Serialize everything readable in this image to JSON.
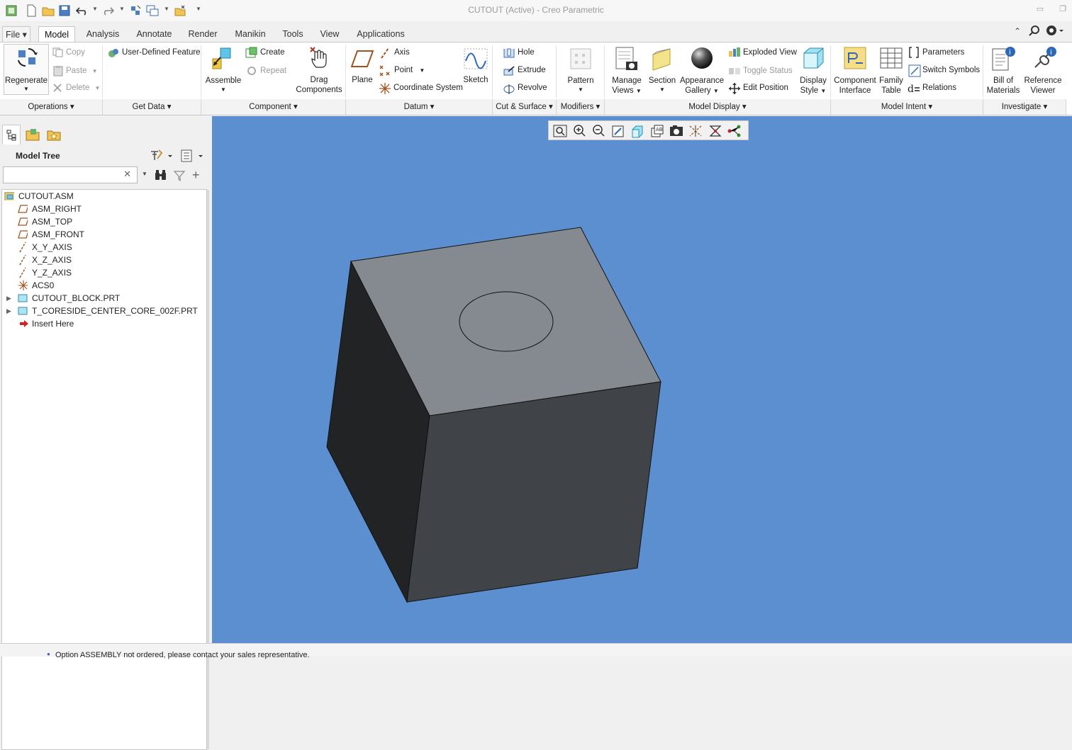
{
  "window": {
    "title": "CUTOUT (Active) - Creo Parametric"
  },
  "tabs": [
    "File",
    "Model",
    "Analysis",
    "Annotate",
    "Render",
    "Manikin",
    "Tools",
    "View",
    "Applications"
  ],
  "ribbon": {
    "operations": {
      "regenerate": "Regenerate",
      "copy": "Copy",
      "paste": "Paste",
      "delete": "Delete",
      "group": "Operations"
    },
    "get_data": {
      "udf": "User-Defined Feature",
      "group": "Get Data"
    },
    "component": {
      "assemble": "Assemble",
      "create": "Create",
      "repeat": "Repeat",
      "drag": [
        "Drag",
        "Components"
      ],
      "group": "Component"
    },
    "datum": {
      "plane": "Plane",
      "axis": "Axis",
      "point": "Point",
      "csys": "Coordinate System",
      "sketch": "Sketch",
      "group": "Datum"
    },
    "cut_surface": {
      "hole": "Hole",
      "extrude": "Extrude",
      "revolve": "Revolve",
      "group": "Cut & Surface"
    },
    "modifiers": {
      "pattern": "Pattern",
      "group": "Modifiers"
    },
    "model_display": {
      "manage_views": [
        "Manage",
        "Views"
      ],
      "section": "Section",
      "appearance": [
        "Appearance",
        "Gallery"
      ],
      "exploded": "Exploded View",
      "toggle_status": "Toggle Status",
      "edit_position": "Edit Position",
      "display_style": [
        "Display",
        "Style"
      ],
      "group": "Model Display"
    },
    "model_intent": {
      "component_interface": [
        "Component",
        "Interface"
      ],
      "family_table": [
        "Family",
        "Table"
      ],
      "parameters": "Parameters",
      "switch_symbols": "Switch Symbols",
      "relations": "Relations",
      "group": "Model Intent"
    },
    "investigate": {
      "bom": [
        "Bill of",
        "Materials"
      ],
      "ref_viewer": [
        "Reference",
        "Viewer"
      ],
      "group": "Investigate"
    }
  },
  "model_tree": {
    "title": "Model Tree",
    "search_value": "",
    "items": [
      {
        "label": "CUTOUT.ASM",
        "icon": "assembly-icon"
      },
      {
        "label": "ASM_RIGHT",
        "icon": "datum-plane-icon"
      },
      {
        "label": "ASM_TOP",
        "icon": "datum-plane-icon"
      },
      {
        "label": "ASM_FRONT",
        "icon": "datum-plane-icon"
      },
      {
        "label": "X_Y_AXIS",
        "icon": "datum-axis-icon"
      },
      {
        "label": "X_Z_AXIS",
        "icon": "datum-axis-icon"
      },
      {
        "label": "Y_Z_AXIS",
        "icon": "datum-axis-icon"
      },
      {
        "label": "ACS0",
        "icon": "csys-icon"
      },
      {
        "label": "CUTOUT_BLOCK.PRT",
        "icon": "part-icon"
      },
      {
        "label": "T_CORESIDE_CENTER_CORE_002F.PRT",
        "icon": "part-icon"
      },
      {
        "label": "Insert Here",
        "icon": "insert-arrow-icon"
      }
    ]
  },
  "status": {
    "message": "Option ASSEMBLY not ordered, please contact your sales representative."
  },
  "colors": {
    "viewport_bg": "#5b8fd0",
    "cube_top": "#858a90",
    "cube_front": "#404448",
    "cube_left": "#212325"
  }
}
